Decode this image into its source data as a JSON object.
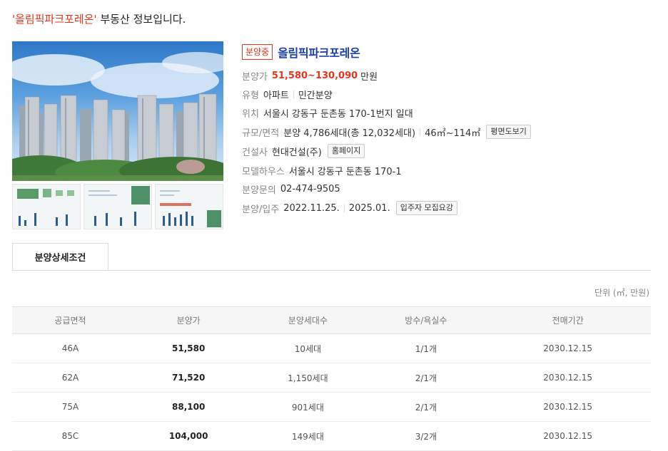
{
  "headline": {
    "highlight": "'올림픽파크포레온'",
    "rest": " 부동산 정보입니다."
  },
  "property": {
    "status_badge": "분양중",
    "name": "올림픽파크포레온",
    "rows": {
      "price": {
        "label": "분양가",
        "value": "51,580~130,090",
        "unit": "만원"
      },
      "type": {
        "label": "유형",
        "value1": "아파트",
        "value2": "민간분양"
      },
      "location": {
        "label": "위치",
        "value": "서울시 강동구 둔촌동 170-1번지 일대"
      },
      "scale": {
        "label": "규모/면적",
        "value1": "분양 4,786세대(총 12,032세대)",
        "value2": "46㎡~114㎡",
        "button": "평면도보기"
      },
      "builder": {
        "label": "건설사",
        "value": "현대건설(주)",
        "button": "홈페이지"
      },
      "model_house": {
        "label": "모델하우스",
        "value": "서울시 강동구 둔촌동 170-1"
      },
      "contact": {
        "label": "분양문의",
        "value": "02-474-9505"
      },
      "schedule": {
        "label": "분양/입주",
        "value1": "2022.11.25.",
        "value2": "2025.01.",
        "button": "입주자 모집요강"
      }
    }
  },
  "tabs": {
    "active": "분양상세조건"
  },
  "unit_note": "단위 (㎡, 만원)",
  "table": {
    "headers": [
      "공급면적",
      "분양가",
      "분양세대수",
      "방수/욕실수",
      "전매기간"
    ],
    "rows": [
      [
        "46A",
        "51,580",
        "10세대",
        "1/1개",
        "2030.12.15"
      ],
      [
        "62A",
        "71,520",
        "1,150세대",
        "2/1개",
        "2030.12.15"
      ],
      [
        "75A",
        "88,100",
        "901세대",
        "2/1개",
        "2030.12.15"
      ],
      [
        "85C",
        "104,000",
        "149세대",
        "3/2개",
        "2030.12.15"
      ]
    ]
  },
  "colors": {
    "accent_red": "#e8341e",
    "title_blue": "#1a3fa8"
  }
}
